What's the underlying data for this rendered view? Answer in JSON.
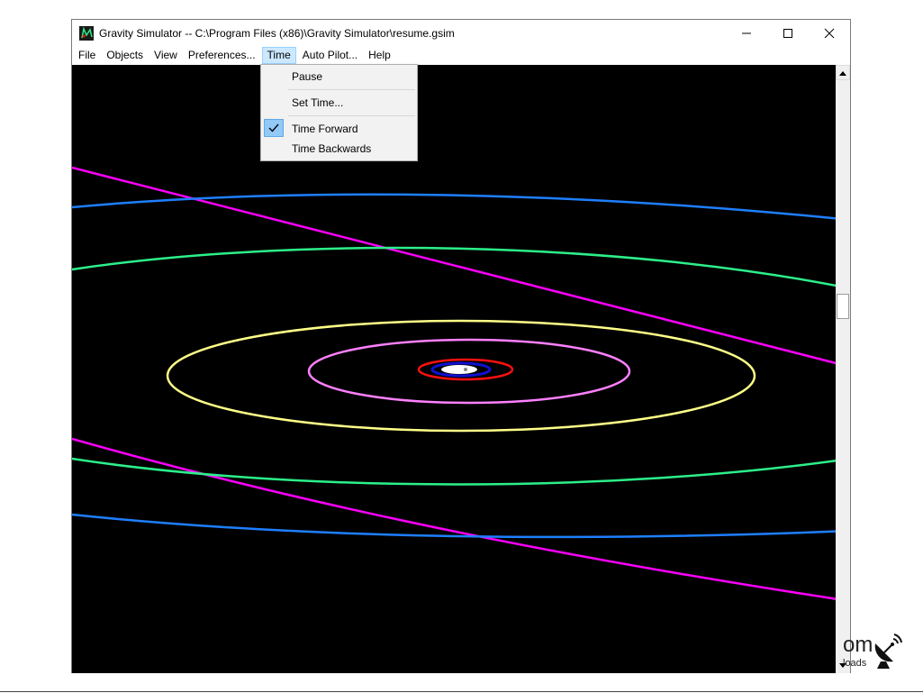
{
  "window": {
    "title": "Gravity Simulator -- C:\\Program Files (x86)\\Gravity Simulator\\resume.gsim",
    "controls": [
      "minimize-icon",
      "maximize-icon",
      "close-icon"
    ]
  },
  "menubar": {
    "items": [
      "File",
      "Objects",
      "View",
      "Preferences...",
      "Time",
      "Auto Pilot...",
      "Help"
    ],
    "active": "Time"
  },
  "time_menu": {
    "items": [
      {
        "label": "Pause",
        "checked": false
      },
      {
        "label": "Set Time...",
        "checked": false
      },
      {
        "label": "Time Forward",
        "checked": true
      },
      {
        "label": "Time Backwards",
        "checked": false
      }
    ]
  },
  "simulation": {
    "background": "#000000",
    "orbit_colors": {
      "magenta": "#ff00ff",
      "blue": "#1e7fff",
      "green": "#2cf08a",
      "yellow": "#ffff88",
      "pink": "#ff80ff",
      "red": "#ff1010",
      "darkblue": "#1010d0",
      "white": "#ffffff"
    }
  },
  "watermark": {
    "text_main": "om",
    "text_sub": "loads",
    "icon": "satellite-dish-icon"
  }
}
